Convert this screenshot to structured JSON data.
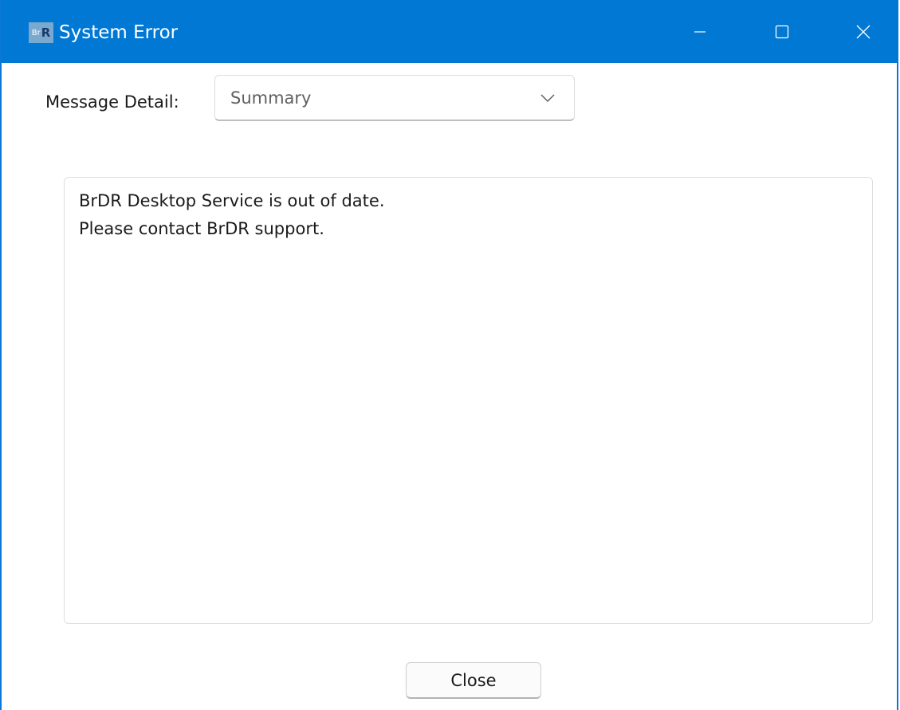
{
  "window": {
    "title": "System Error",
    "app_icon": {
      "name": "brdr-app-icon",
      "text_small": "Br",
      "text_large": "R",
      "color": "#7aa9cf"
    },
    "titlebar_color": "#0078d4",
    "controls": {
      "minimize": "minimize-icon",
      "maximize": "maximize-icon",
      "close": "close-icon"
    }
  },
  "message_detail": {
    "label": "Message Detail:",
    "selected": "Summary",
    "icon": "chevron-down-icon"
  },
  "message": {
    "lines": [
      "BrDR Desktop Service is out of date.",
      "Please contact BrDR support."
    ]
  },
  "footer": {
    "close_label": "Close"
  }
}
